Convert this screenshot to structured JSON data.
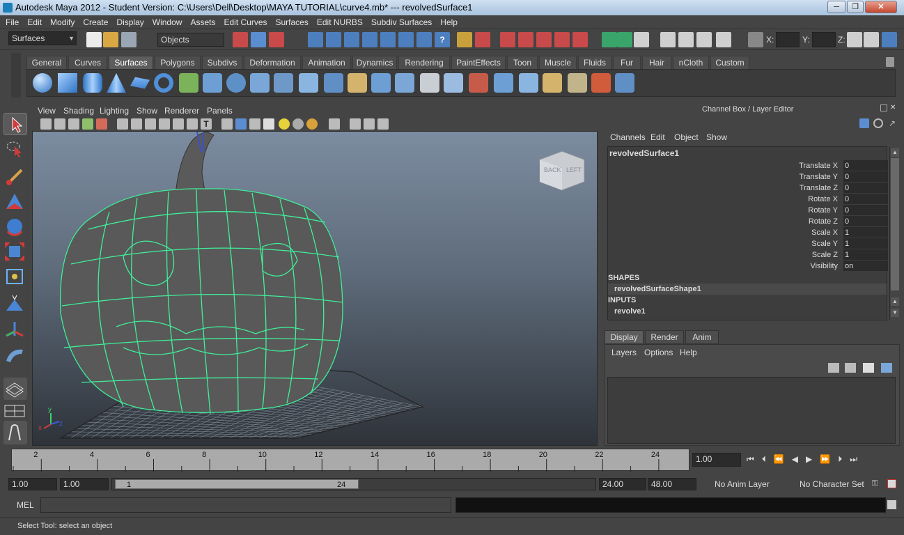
{
  "window": {
    "title": "Autodesk Maya 2012 - Student Version: C:\\Users\\Dell\\Desktop\\MAYA TUTORIAL\\curve4.mb*   ---   revolvedSurface1",
    "min_label": "─",
    "max_label": "❐",
    "close_label": "✕"
  },
  "menubar": {
    "items": [
      "File",
      "Edit",
      "Modify",
      "Create",
      "Display",
      "Window",
      "Assets",
      "Edit Curves",
      "Surfaces",
      "Edit NURBS",
      "Subdiv Surfaces",
      "Help"
    ]
  },
  "statusline": {
    "menuset": "Surfaces",
    "selection_mask": "Objects",
    "x_label": "X:",
    "y_label": "Y:",
    "z_label": "Z:"
  },
  "shelf": {
    "tabs": [
      "General",
      "Curves",
      "Surfaces",
      "Polygons",
      "Subdivs",
      "Deformation",
      "Animation",
      "Dynamics",
      "Rendering",
      "PaintEffects",
      "Toon",
      "Muscle",
      "Fluids",
      "Fur",
      "Hair",
      "nCloth",
      "Custom"
    ],
    "active_tab": "Surfaces"
  },
  "viewport": {
    "menu": [
      "View",
      "Shading",
      "Lighting",
      "Show",
      "Renderer",
      "Panels"
    ],
    "viewcube_back": "BACK",
    "viewcube_left": "LEFT",
    "axis_x": "x",
    "axis_y": "y",
    "axis_z": "z",
    "wireframe_color": "#3ff09a",
    "surface_color": "#5a5a5a"
  },
  "channelbox": {
    "header": "Channel Box / Layer Editor",
    "menu": [
      "Channels",
      "Edit",
      "Object",
      "Show"
    ],
    "object": "revolvedSurface1",
    "channels": [
      {
        "label": "Translate X",
        "value": "0"
      },
      {
        "label": "Translate Y",
        "value": "0"
      },
      {
        "label": "Translate Z",
        "value": "0"
      },
      {
        "label": "Rotate X",
        "value": "0"
      },
      {
        "label": "Rotate Y",
        "value": "0"
      },
      {
        "label": "Rotate Z",
        "value": "0"
      },
      {
        "label": "Scale X",
        "value": "1"
      },
      {
        "label": "Scale Y",
        "value": "1"
      },
      {
        "label": "Scale Z",
        "value": "1"
      },
      {
        "label": "Visibility",
        "value": "on"
      }
    ],
    "shapes_label": "SHAPES",
    "shape_name": "revolvedSurfaceShape1",
    "inputs_label": "INPUTS",
    "input_name": "revolve1"
  },
  "layer_editor": {
    "tabs": [
      "Display",
      "Render",
      "Anim"
    ],
    "active_tab": "Display",
    "menu": [
      "Layers",
      "Options",
      "Help"
    ]
  },
  "timeline": {
    "ticks": [
      "2",
      "4",
      "6",
      "8",
      "10",
      "12",
      "14",
      "16",
      "18",
      "20",
      "22",
      "24"
    ],
    "current_frame": "1.00"
  },
  "range": {
    "start": "1.00",
    "playback_start": "1.00",
    "slider_start": "1",
    "slider_end": "24",
    "playback_end": "24.00",
    "end": "48.00",
    "anim_layer": "No Anim Layer",
    "character_set": "No Character Set"
  },
  "command": {
    "mel_label": "MEL"
  },
  "helpline": {
    "text": "Select Tool: select an object"
  }
}
